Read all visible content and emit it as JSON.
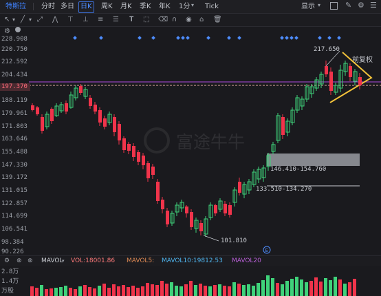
{
  "topbar": {
    "symbol": "特斯拉",
    "tabs": [
      "分时",
      "多日",
      "日K",
      "周K",
      "月K",
      "季K",
      "年K",
      "1分",
      "Tick"
    ],
    "active_tab": "日K",
    "display_label": "显示"
  },
  "colors": {
    "up": "#3fd27a",
    "down": "#f0344b",
    "accent": "#4e8dff",
    "purple": "#b04ce0",
    "yellow": "#f2c23a"
  },
  "price_axis": [
    "228.908",
    "220.750",
    "212.592",
    "204.434",
    "197.370",
    "188.119",
    "179.961",
    "171.803",
    "163.646",
    "155.488",
    "147.330",
    "139.172",
    "131.015",
    "122.857",
    "114.699",
    "106.541",
    "98.384",
    "90.226"
  ],
  "current_price": "197.370",
  "right_label": "前复权",
  "annotations": {
    "high": "217.650",
    "low": "101.810",
    "zone1": "146.410-154.760",
    "zone2": "133.510-134.270"
  },
  "volume": {
    "title": "MAVOL",
    "vol": "VOL:18001.86",
    "mavol5": "MAVOL5:",
    "mavol10": "MAVOL10:19812.53",
    "mavol20": "MAVOL20",
    "axis": [
      "2.8万",
      "1.4万",
      "万股"
    ]
  },
  "watermark": "富途牛牛"
}
